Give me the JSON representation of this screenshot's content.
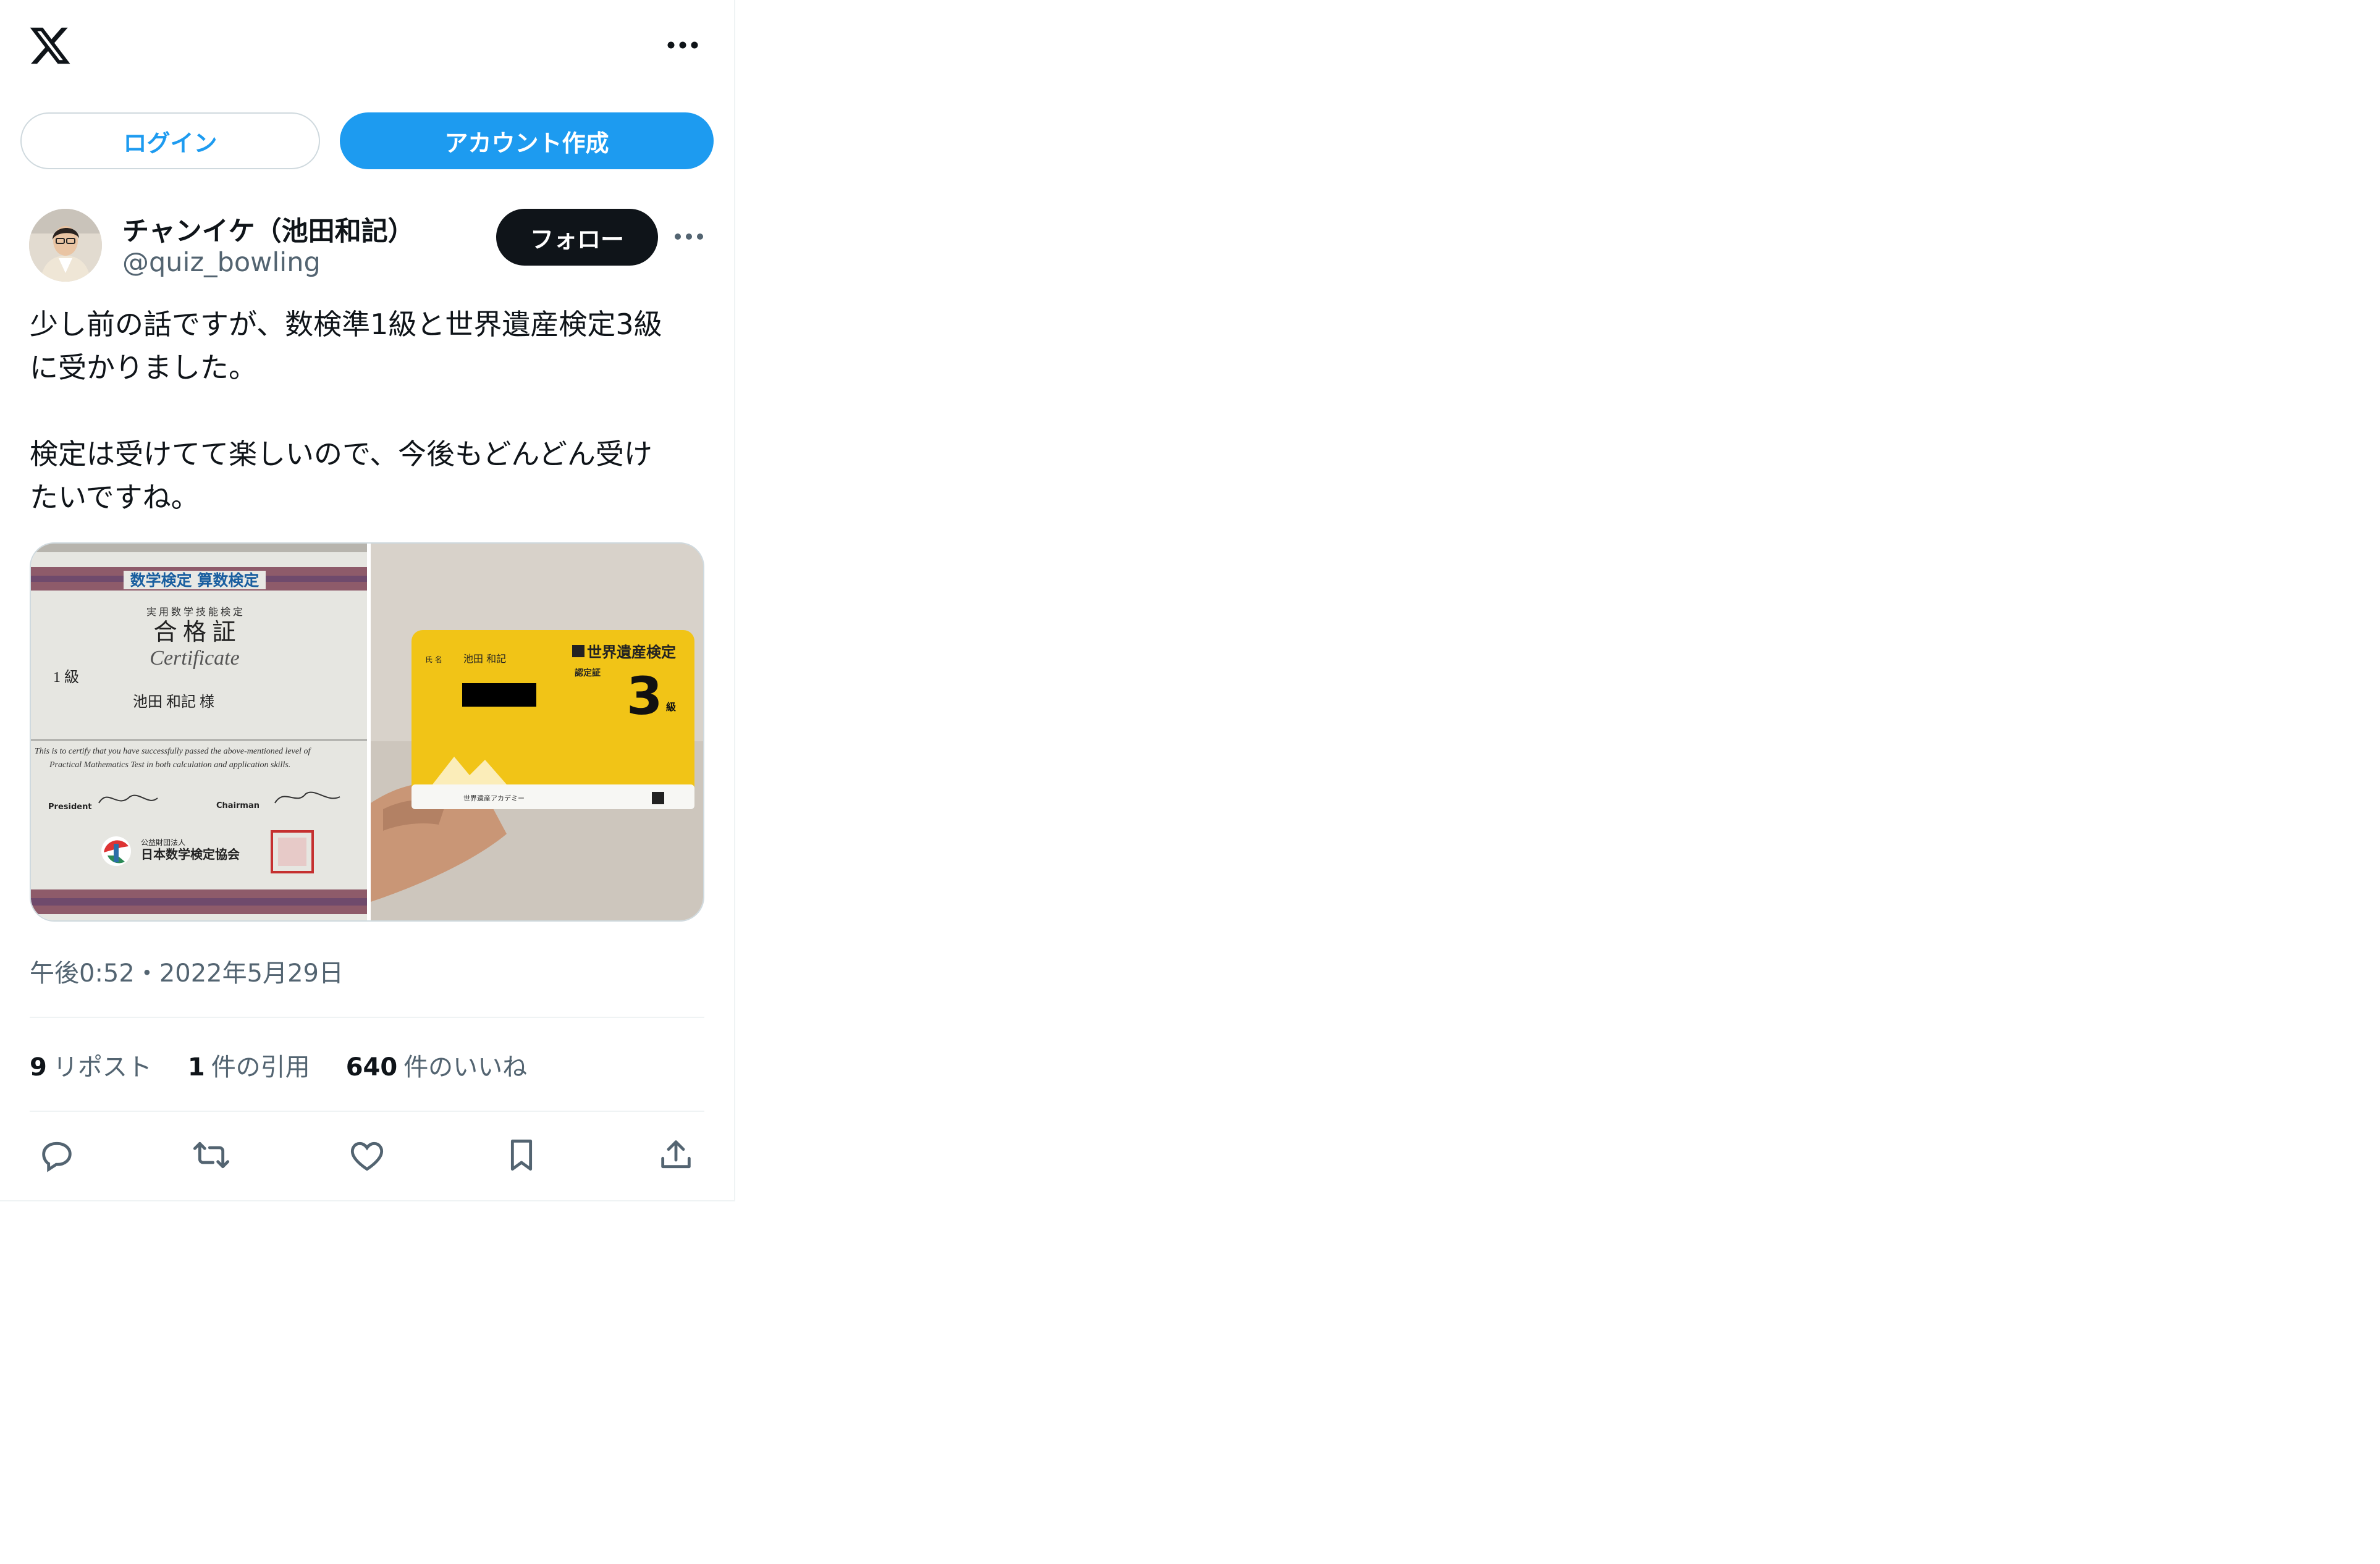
{
  "header": {
    "logo_icon": "x-logo-icon",
    "more_icon": "more-horizontal-icon"
  },
  "auth": {
    "login_label": "ログイン",
    "signup_label": "アカウント作成",
    "accent_color": "#1d9bf0"
  },
  "tweet": {
    "author": {
      "display_name": "チャンイケ（池田和記）",
      "handle": "@quiz_bowling",
      "follow_label": "フォロー"
    },
    "text_lines": [
      "少し前の話ですが、数検準1級と世界遺産検定3級",
      "に受かりました。",
      "検定は受けてて楽しいので、今後もどんどん受け",
      "たいですね。"
    ],
    "images": [
      {
        "name": "math-certificate-photo",
        "texts": {
          "banner": "数学検定 算数検定",
          "subtitle": "実 用 数 学 技 能 検 定",
          "title": "合 格 証",
          "certificate": "Certificate",
          "grade": "1 級",
          "name": "池田 和記   様",
          "english1": "This is to certify that you have successfully passed the above-mentioned level of",
          "english2": "Practical Mathematics Test in both calculation and application skills.",
          "president": "President",
          "chairman": "Chairman",
          "org_small": "公益財団法人",
          "org": "日本数学検定協会"
        }
      },
      {
        "name": "world-heritage-card-photo",
        "texts": {
          "title": "世界遺産検定",
          "cert_label": "認定証",
          "name": "池田 和記",
          "grade_number": "3",
          "grade_suffix": "級",
          "footer": "世界遺産アカデミー"
        }
      }
    ],
    "timestamp": "午後0:52・2022年5月29日",
    "stats": {
      "reposts_count": "9",
      "reposts_label": "リポスト",
      "quotes_count": "1",
      "quotes_label": "件の引用",
      "likes_count": "640",
      "likes_label": "件のいいね"
    },
    "actions": [
      "reply-icon",
      "repost-icon",
      "like-icon",
      "bookmark-icon",
      "share-icon"
    ]
  }
}
